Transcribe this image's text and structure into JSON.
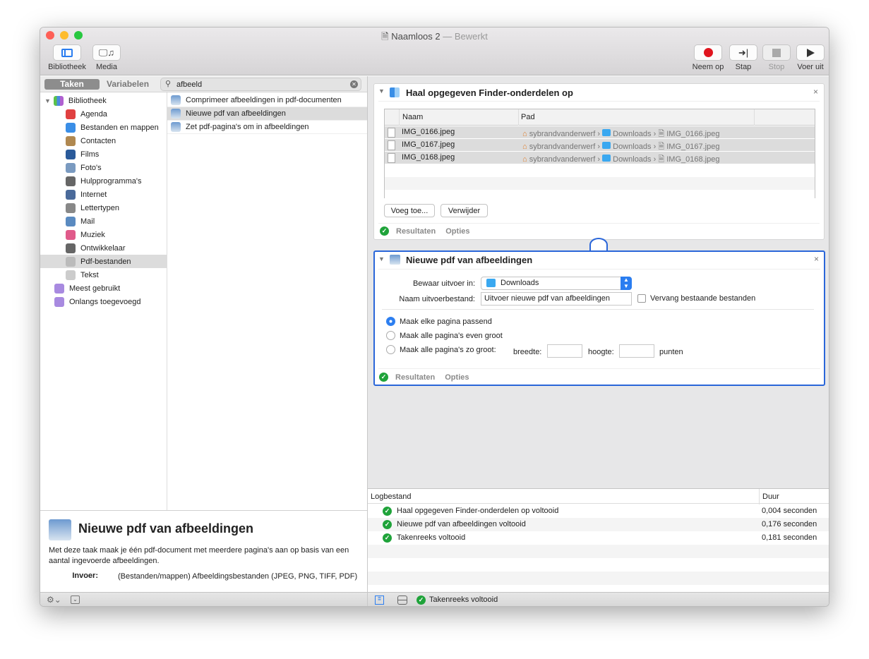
{
  "window": {
    "title": "Naamloos 2",
    "title_sep": " — ",
    "status": "Bewerkt"
  },
  "toolbar": {
    "library": "Bibliotheek",
    "media": "Media",
    "record": "Neem op",
    "step": "Stap",
    "stop": "Stop",
    "run": "Voer uit"
  },
  "library": {
    "tab_actions": "Taken",
    "tab_variables": "Variabelen",
    "search_value": "afbeeld",
    "root": "Bibliotheek",
    "categories": [
      {
        "label": "Agenda",
        "icon": "calendar-icon",
        "color": "#e04040"
      },
      {
        "label": "Bestanden en mappen",
        "icon": "finder-icon",
        "color": "#3a8ee6"
      },
      {
        "label": "Contacten",
        "icon": "contacts-icon",
        "color": "#b08850"
      },
      {
        "label": "Films",
        "icon": "quicktime-icon",
        "color": "#2a5a9a"
      },
      {
        "label": "Foto's",
        "icon": "photos-icon",
        "color": "#7a9ac0"
      },
      {
        "label": "Hulpprogramma's",
        "icon": "tools-icon",
        "color": "#666"
      },
      {
        "label": "Internet",
        "icon": "globe-icon",
        "color": "#4a6a9a"
      },
      {
        "label": "Lettertypen",
        "icon": "font-icon",
        "color": "#888"
      },
      {
        "label": "Mail",
        "icon": "mail-icon",
        "color": "#5a8ac0"
      },
      {
        "label": "Muziek",
        "icon": "music-icon",
        "color": "#e05a8a"
      },
      {
        "label": "Ontwikkelaar",
        "icon": "tools-icon",
        "color": "#666"
      },
      {
        "label": "Pdf-bestanden",
        "icon": "pdf-icon",
        "color": "#bbb"
      },
      {
        "label": "Tekst",
        "icon": "text-icon",
        "color": "#ccc"
      }
    ],
    "smart": [
      {
        "label": "Meest gebruikt"
      },
      {
        "label": "Onlangs toegevoegd"
      }
    ],
    "actions": [
      "Comprimeer afbeeldingen in pdf-documenten",
      "Nieuwe pdf van afbeeldingen",
      "Zet pdf-pagina's om in afbeeldingen"
    ],
    "selected_category": "Pdf-bestanden",
    "selected_action": "Nieuwe pdf van afbeeldingen"
  },
  "description": {
    "title": "Nieuwe pdf van afbeeldingen",
    "text": "Met deze taak maak je één pdf-document met meerdere pagina's aan op basis van een aantal ingevoerde afbeeldingen.",
    "input_label": "Invoer:",
    "input_value": "(Bestanden/mappen) Afbeeldingsbestanden (JPEG, PNG, TIFF, PDF)"
  },
  "action1": {
    "title": "Haal opgegeven Finder-onderdelen op",
    "col_name": "Naam",
    "col_path": "Pad",
    "rows": [
      {
        "name": "IMG_0166.jpeg",
        "user": "sybrandvanderwerf",
        "folder": "Downloads",
        "file": "IMG_0166.jpeg"
      },
      {
        "name": "IMG_0167.jpeg",
        "user": "sybrandvanderwerf",
        "folder": "Downloads",
        "file": "IMG_0167.jpeg"
      },
      {
        "name": "IMG_0168.jpeg",
        "user": "sybrandvanderwerf",
        "folder": "Downloads",
        "file": "IMG_0168.jpeg"
      }
    ],
    "add": "Voeg toe...",
    "remove": "Verwijder",
    "results": "Resultaten",
    "options": "Opties"
  },
  "action2": {
    "title": "Nieuwe pdf van afbeeldingen",
    "save_label": "Bewaar uitvoer in:",
    "save_value": "Downloads",
    "name_label": "Naam uitvoerbestand:",
    "name_value": "Uitvoer nieuwe pdf van afbeeldingen",
    "replace_label": "Vervang bestaande bestanden",
    "replace_checked": false,
    "radios": [
      {
        "label": "Maak elke pagina passend",
        "selected": true
      },
      {
        "label": "Maak alle pagina's even groot",
        "selected": false
      },
      {
        "label": "Maak alle pagina's zo groot:",
        "selected": false
      }
    ],
    "width_label": "breedte:",
    "width_value": "",
    "height_label": "hoogte:",
    "height_value": "",
    "unit": "punten",
    "results": "Resultaten",
    "options": "Opties"
  },
  "log": {
    "col_log": "Logbestand",
    "col_duration": "Duur",
    "rows": [
      {
        "text": "Haal opgegeven Finder-onderdelen op voltooid",
        "duration": "0,004 seconden"
      },
      {
        "text": "Nieuwe pdf van afbeeldingen voltooid",
        "duration": "0,176 seconden"
      },
      {
        "text": "Takenreeks voltooid",
        "duration": "0,181 seconden"
      }
    ]
  },
  "statusbar": {
    "text": "Takenreeks voltooid"
  },
  "colors": {
    "accent": "#2a66d9",
    "success": "#1fa33a",
    "record": "#e0141e"
  }
}
